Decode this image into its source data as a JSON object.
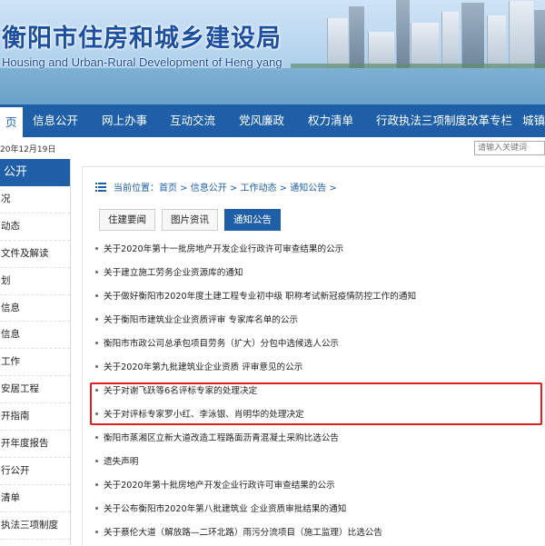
{
  "header": {
    "title_cn": "衡阳市住房和城乡建设局",
    "title_en": "Housing and Urban-Rural Development of Heng yang"
  },
  "nav": [
    {
      "label": "页"
    },
    {
      "label": "信息公开"
    },
    {
      "label": "网上办事"
    },
    {
      "label": "互动交流"
    },
    {
      "label": "党风廉政"
    },
    {
      "label": "权力清单"
    },
    {
      "label": "行政执法三项制度改革专栏"
    },
    {
      "label": "城镇"
    }
  ],
  "topbar": {
    "date": "20年12月19日",
    "search_placeholder": "请输入关键词"
  },
  "sidebar": {
    "title": "公开",
    "items": [
      {
        "label": "况"
      },
      {
        "label": "动态"
      },
      {
        "label": "文件及解读"
      },
      {
        "label": "划"
      },
      {
        "label": "信息"
      },
      {
        "label": "信息"
      },
      {
        "label": "工作"
      },
      {
        "label": "安居工程"
      },
      {
        "label": "开指南"
      },
      {
        "label": "开年度报告"
      },
      {
        "label": "行公开"
      },
      {
        "label": "清单"
      },
      {
        "label": "执法三项制度"
      }
    ]
  },
  "breadcrumb": "当前位置：首页 > 信息公开 > 工作动态 > 通知公告 >",
  "tabs": [
    {
      "label": "住建要闻",
      "active": false
    },
    {
      "label": "图片资讯",
      "active": false
    },
    {
      "label": "通知公告",
      "active": true
    }
  ],
  "notices": [
    "关于2020年第十一批房地产开发企业行政许可审查结果的公示",
    "关于建立施工劳务企业资源库的通知",
    "关于做好衡阳市2020年度土建工程专业初中级 职称考试新冠疫情防控工作的通知",
    "关于衡阳市建筑业企业资质评审 专家库名单的公示",
    "衡阳市市政公司总承包项目劳务（扩大）分包中选候选人公示",
    "关于2020年第九批建筑业企业资质 评审意见的公示",
    "关于对谢飞跃等6名评标专家的处理决定",
    "关于对评标专家罗小红、李泳银、肖明华的处理决定",
    "衡阳市蒸湘区立新大道改造工程路面沥青混凝土采购比选公告",
    "遗失声明",
    "关于2020年第十批房地产开发企业行政许可审查结果的公示",
    "关于公布衡阳市2020年第八批建筑业 企业资质审批结果的通知",
    "关于蔡伦大道（解放路—二环北路）雨污分流项目（施工监理）比选公告"
  ],
  "colors": {
    "primary": "#1e5fa8",
    "highlight": "#e02020"
  }
}
